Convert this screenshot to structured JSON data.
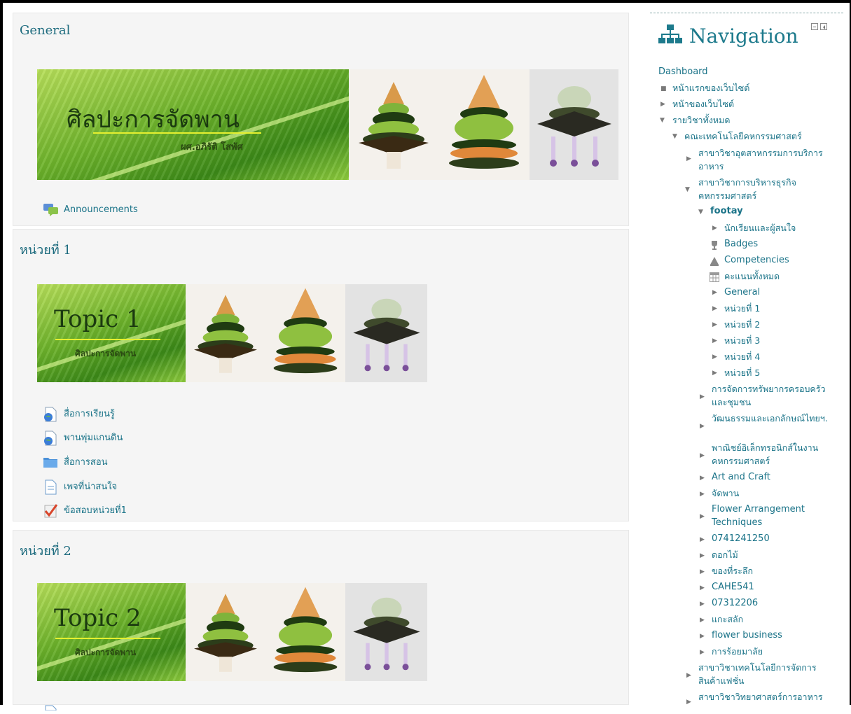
{
  "sections": [
    {
      "title": "General",
      "banner": {
        "title": "ศิลปะการจัดพาน",
        "subtitle": "ผศ.อภิรัติ โสพัศ"
      },
      "activities": [
        {
          "label": "Announcements",
          "icon": "forum-icon"
        }
      ]
    },
    {
      "title": "หน่วยที่ 1",
      "banner": {
        "title": "Topic 1",
        "subtitle": "ศิลปะการจัดพาน"
      },
      "activities": [
        {
          "label": "สื่อการเรียนรู้",
          "icon": "url-icon"
        },
        {
          "label": "พานพุ่มแกนดิน",
          "icon": "url-icon"
        },
        {
          "label": "สื่อการสอน",
          "icon": "folder-icon"
        },
        {
          "label": "เพจที่น่าสนใจ",
          "icon": "page-icon"
        },
        {
          "label": "ข้อสอบหน่วยที่1",
          "icon": "quiz-icon"
        }
      ]
    },
    {
      "title": "หน่วยที่ 2",
      "banner": {
        "title": "Topic 2",
        "subtitle": "ศิลปะการจัดพาน"
      },
      "activities": []
    }
  ],
  "navigation": {
    "title": "Navigation",
    "items": [
      {
        "label": "Dashboard"
      },
      {
        "label": "หน้าแรกของเว็บไซต์"
      },
      {
        "label": "หน้าของเว็บไซต์"
      },
      {
        "label": "รายวิชาทั้งหมด"
      },
      {
        "label": "คณะเทคโนโลยีคหกรรมศาสตร์"
      },
      {
        "label": "สาขาวิชาอุตสาหกรรมการบริการอาหาร"
      },
      {
        "label": "สาขาวิชาการบริหารธุรกิจคหกรรมศาสตร์"
      },
      {
        "label": "footay"
      },
      {
        "label": "นักเรียนและผู้สนใจ"
      },
      {
        "label": "Badges"
      },
      {
        "label": "Competencies"
      },
      {
        "label": "คะแนนทั้งหมด"
      },
      {
        "label": "General"
      },
      {
        "label": "หน่วยที่ 1"
      },
      {
        "label": "หน่วยที่ 2"
      },
      {
        "label": "หน่วยที่ 3"
      },
      {
        "label": "หน่วยที่ 4"
      },
      {
        "label": "หน่วยที่ 5"
      },
      {
        "label": "การจัดการทรัพยากรครอบครัวและชุมชน"
      },
      {
        "label": "วัฒนธรรมและเอกลักษณ์ไทยฯ."
      },
      {
        "label": "พาณิชย์อิเล็กทรอนิกส์ในงานคหกรรมศาสตร์"
      },
      {
        "label": "Art and Craft"
      },
      {
        "label": "จัดพาน"
      },
      {
        "label": "Flower Arrangement Techniques"
      },
      {
        "label": "0741241250"
      },
      {
        "label": "ดอกไม้"
      },
      {
        "label": "ของที่ระลึก"
      },
      {
        "label": "CAHE541"
      },
      {
        "label": "07312206"
      },
      {
        "label": "แกะสลัก"
      },
      {
        "label": "flower business"
      },
      {
        "label": "การร้อยมาลัย"
      },
      {
        "label": "สาขาวิชาเทคโนโลยีการจัดการสินค้าแฟชั่น"
      },
      {
        "label": "สาขาวิชาวิทยาศาสตร์การอาหาร"
      }
    ]
  }
}
